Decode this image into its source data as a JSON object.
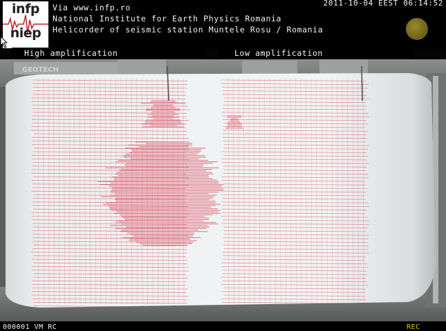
{
  "logo": {
    "line1": "infp",
    "line2": "niep"
  },
  "header": {
    "via": "Via www.infp.ro",
    "institute": "National Institute for Earth Physics Romania",
    "station": "Helicorder of seismic station Muntele Rosu / Romania",
    "timestamp": "2011-10-04 EEST 06:14:52"
  },
  "amplification": {
    "high": "High amplification",
    "low": "Low amplification"
  },
  "drum": {
    "maker_label": "GEOTECH"
  },
  "footer": {
    "camera_id": "000001 VM RC",
    "recording": "REC"
  },
  "colors": {
    "trace": "#d8394d",
    "paper": "#eef1f3",
    "status_dot": "#7d6f20",
    "rec": "#f2c500"
  },
  "icons": {
    "cursor": "arrow-cursor-icon",
    "status": "status-dot-icon"
  }
}
